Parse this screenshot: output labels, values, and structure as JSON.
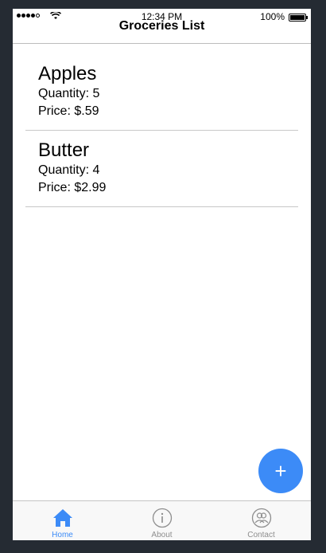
{
  "status_bar": {
    "time": "12:34 PM",
    "battery": "100%"
  },
  "nav": {
    "title": "Groceries List"
  },
  "items": [
    {
      "name": "Apples",
      "quantity": "Quantity: 5",
      "price": "Price: $.59"
    },
    {
      "name": "Butter",
      "quantity": "Quantity: 4",
      "price": "Price: $2.99"
    }
  ],
  "fab": {
    "icon": "plus-icon",
    "label": "+"
  },
  "tabs": [
    {
      "label": "Home",
      "icon": "home-icon",
      "active": true
    },
    {
      "label": "About",
      "icon": "info-icon",
      "active": false
    },
    {
      "label": "Contact",
      "icon": "contacts-icon",
      "active": false
    }
  ],
  "colors": {
    "accent": "#3c8bf7",
    "background": "#252b33"
  }
}
